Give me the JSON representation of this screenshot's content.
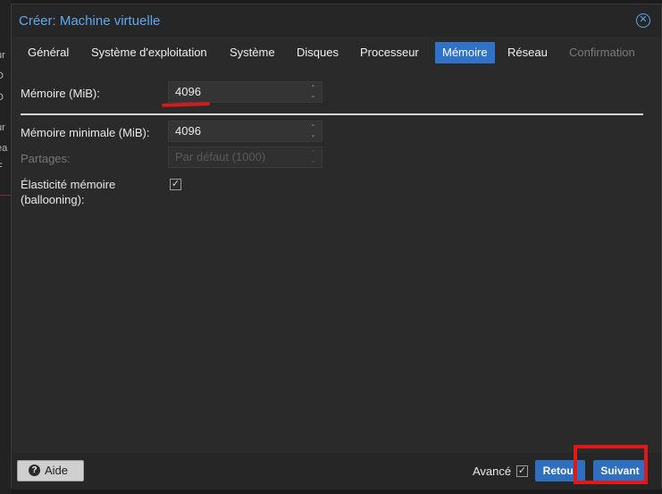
{
  "background": {
    "fragments": [
      "ur",
      "D",
      "D",
      "ur",
      "ea",
      "F"
    ]
  },
  "dialog": {
    "title": "Créer: Machine virtuelle",
    "close_glyph": "✕"
  },
  "tabs": [
    {
      "label": "Général",
      "state": "normal"
    },
    {
      "label": "Système d'exploitation",
      "state": "normal"
    },
    {
      "label": "Système",
      "state": "normal"
    },
    {
      "label": "Disques",
      "state": "normal"
    },
    {
      "label": "Processeur",
      "state": "normal"
    },
    {
      "label": "Mémoire",
      "state": "active"
    },
    {
      "label": "Réseau",
      "state": "normal"
    },
    {
      "label": "Confirmation",
      "state": "disabled"
    }
  ],
  "form": {
    "memory": {
      "label": "Mémoire (MiB):",
      "value": "4096"
    },
    "min_memory": {
      "label": "Mémoire minimale (MiB):",
      "value": "4096"
    },
    "shares": {
      "label": "Partages:",
      "placeholder": "Par défaut (1000)"
    },
    "ballooning": {
      "label_line1": "Élasticité mémoire",
      "label_line2": "(ballooning):",
      "checked": true
    }
  },
  "footer": {
    "help_label": "Aide",
    "help_icon": "?",
    "advanced_label": "Avancé",
    "advanced_checked": true,
    "back_label": "Retour",
    "next_label": "Suivant"
  },
  "colors": {
    "accent": "#2f72c8",
    "title": "#5ea8f2",
    "annotation": "#e01818"
  }
}
